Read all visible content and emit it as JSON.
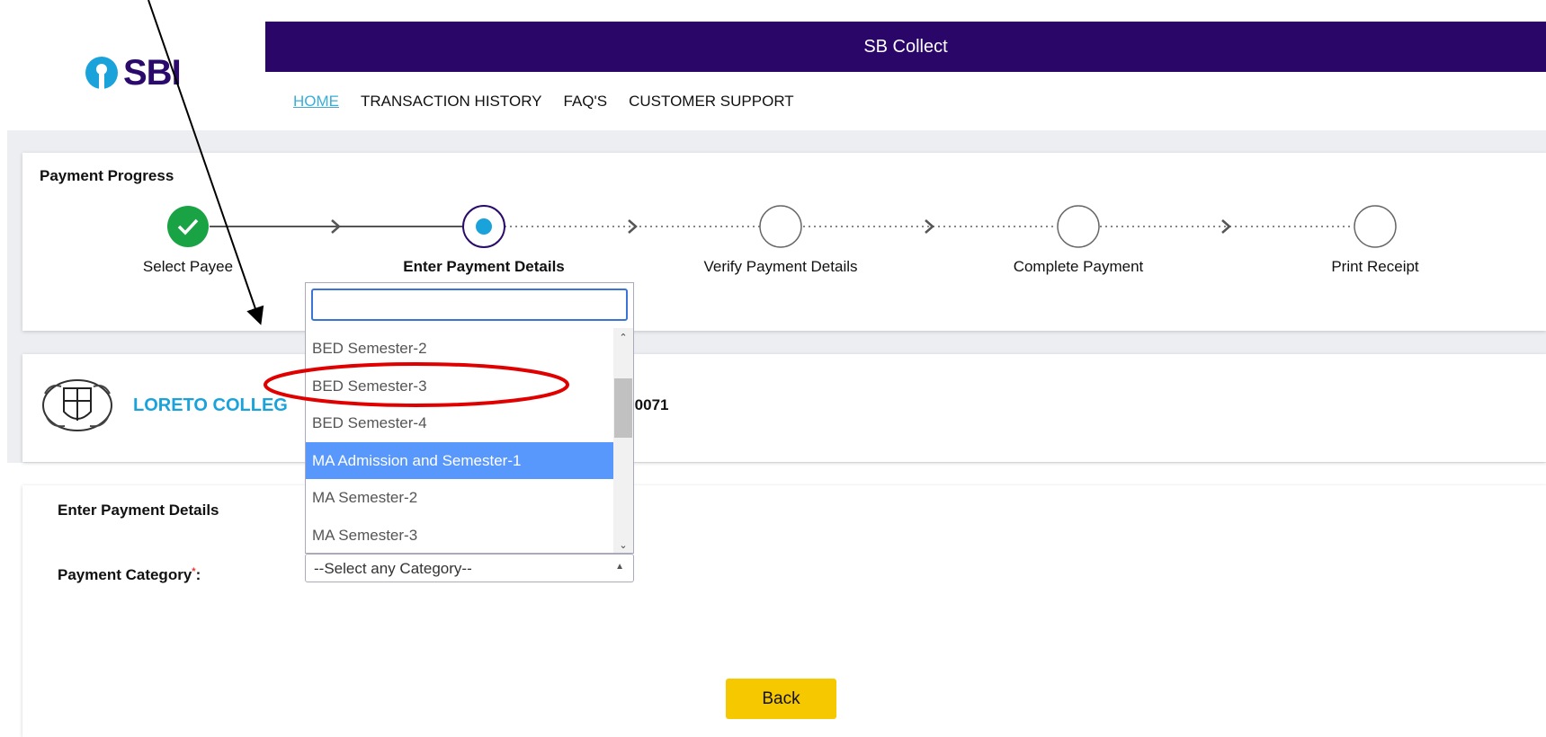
{
  "header": {
    "title": "SB Collect",
    "logo_text": "SBI"
  },
  "nav": [
    {
      "label": "HOME",
      "active": true
    },
    {
      "label": "TRANSACTION HISTORY",
      "active": false
    },
    {
      "label": "FAQ'S",
      "active": false
    },
    {
      "label": "CUSTOMER SUPPORT",
      "active": false
    }
  ],
  "progress": {
    "title": "Payment Progress",
    "steps": [
      {
        "label": "Select Payee",
        "status": "done"
      },
      {
        "label": "Enter Payment Details",
        "status": "current"
      },
      {
        "label": "Verify Payment Details",
        "status": "pending"
      },
      {
        "label": "Complete Payment",
        "status": "pending"
      },
      {
        "label": "Print Receipt",
        "status": "pending"
      }
    ]
  },
  "college": {
    "name": "LORETO COLLEG",
    "code_fragment": ")0071"
  },
  "payment": {
    "title": "Enter Payment Details",
    "category_label": "Payment Category",
    "required_mark": "*",
    "colon": ":",
    "select_placeholder": "--Select any Category--"
  },
  "dropdown": {
    "search_value": "",
    "options": [
      "BED Semester-2",
      "BED Semester-3",
      "BED Semester-4",
      "MA Admission and Semester-1",
      "MA Semester-2",
      "MA Semester-3"
    ],
    "highlighted": "MA Admission and Semester-1",
    "circled": "BED Semester-3"
  },
  "buttons": {
    "back": "Back"
  },
  "colors": {
    "banner": "#2a0668",
    "accent": "#1aa3da",
    "step_done": "#1aa345",
    "highlight": "#5897fb",
    "annotation": "#e00000",
    "back_button": "#f5c800"
  }
}
